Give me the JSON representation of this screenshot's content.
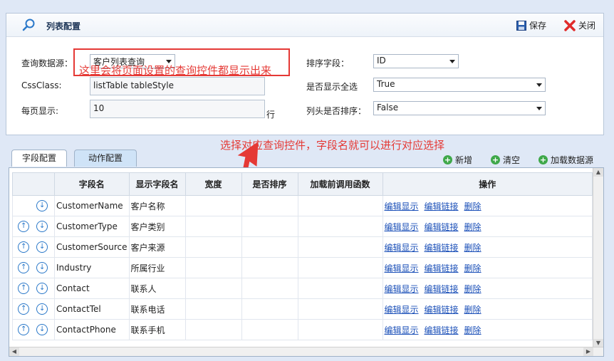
{
  "panel": {
    "title": "列表配置",
    "save_label": "保存",
    "close_label": "关闭"
  },
  "form": {
    "datasource_label": "查询数据源：",
    "datasource_value": "客户列表查询",
    "cssclass_label": "CssClass:",
    "cssclass_value": "listTable tableStyle",
    "pagesize_label": "每页显示:",
    "pagesize_value": "10",
    "pagesize_unit": "行",
    "sortfield_label": "排序字段：",
    "sortfield_value": "ID",
    "showall_label": "是否显示全选",
    "showall_value": "True",
    "headersort_label": "列头是否排序：",
    "headersort_value": "False"
  },
  "annotations": {
    "note1": "这里会将页面设置的查询控件都显示出来",
    "note2": "选择对应查询控件，字段名就可以进行对应选择",
    "color": "#e53935"
  },
  "tabs": [
    {
      "label": "字段配置"
    },
    {
      "label": "动作配置"
    }
  ],
  "toolbar": {
    "add_label": "新增",
    "clear_label": "清空",
    "load_label": "加载数据源"
  },
  "grid": {
    "headers": [
      "字段名",
      "显示字段名",
      "宽度",
      "是否排序",
      "加载前调用函数",
      "操作"
    ],
    "action_labels": [
      "编辑显示",
      "编辑链接",
      "删除"
    ],
    "rows": [
      {
        "field": "CustomerName",
        "display": "客户名称"
      },
      {
        "field": "CustomerType",
        "display": "客户类别"
      },
      {
        "field": "CustomerSource",
        "display": "客户来源"
      },
      {
        "field": "Industry",
        "display": "所属行业"
      },
      {
        "field": "Contact",
        "display": "联系人"
      },
      {
        "field": "ContactTel",
        "display": "联系电话"
      },
      {
        "field": "ContactPhone",
        "display": "联系手机"
      }
    ]
  }
}
